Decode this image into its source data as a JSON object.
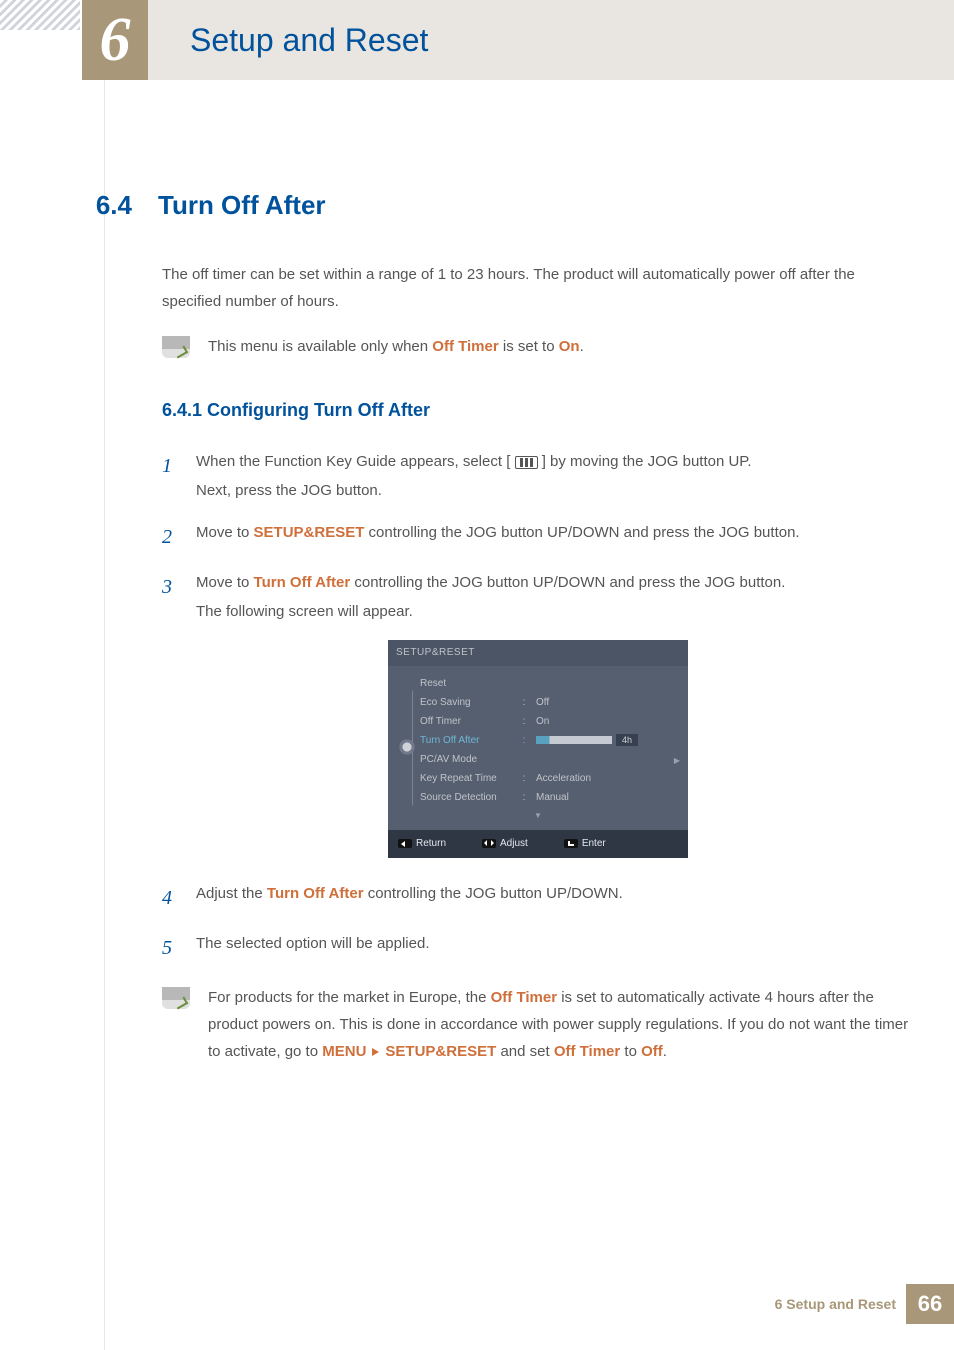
{
  "chapter": {
    "num": "6",
    "title": "Setup and Reset"
  },
  "section": {
    "num": "6.4",
    "title": "Turn Off After"
  },
  "intro": "The off timer can be set within a range of 1 to 23 hours. The product will automatically power off after the specified number of hours.",
  "note1": {
    "p1": "This menu is available only when ",
    "h1": "Off Timer",
    "p2": " is set to ",
    "h2": "On",
    "p3": "."
  },
  "subsection": "6.4.1   Configuring Turn Off After",
  "steps": {
    "s1a": "When the Function Key Guide appears, select ",
    "s1b": " by moving the JOG button UP.",
    "s1c": "Next, press the JOG button.",
    "s2a": "Move to ",
    "s2h": "SETUP&RESET",
    "s2b": " controlling the JOG button UP/DOWN and press the JOG button.",
    "s3a": "Move to ",
    "s3h": "Turn Off After",
    "s3b": " controlling the JOG button UP/DOWN and press the JOG button.",
    "s3c": "The following screen will appear.",
    "s4a": "Adjust the ",
    "s4h": "Turn Off After",
    "s4b": " controlling the JOG button UP/DOWN.",
    "s5": "The selected option will be applied."
  },
  "osd": {
    "header": "SETUP&RESET",
    "items": [
      {
        "label": "Reset",
        "value": ""
      },
      {
        "label": "Eco Saving",
        "value": "Off"
      },
      {
        "label": "Off Timer",
        "value": "On"
      },
      {
        "label": "Turn Off After",
        "value": "4h",
        "highlight": true,
        "bar": true
      },
      {
        "label": "PC/AV Mode",
        "value": "",
        "chev": true
      },
      {
        "label": "Key Repeat Time",
        "value": "Acceleration"
      },
      {
        "label": "Source Detection",
        "value": "Manual"
      }
    ],
    "footer": {
      "return": "Return",
      "adjust": "Adjust",
      "enter": "Enter"
    }
  },
  "note2": {
    "p1": "For products for the market in Europe, the ",
    "h1": "Off Timer",
    "p2": " is set to automatically activate 4 hours after the product powers on. This is done in accordance with power supply regulations. If you do not want the timer to activate, go to ",
    "h2": "MENU",
    "h3": "SETUP&RESET",
    "p3": " and set ",
    "h4": "Off Timer",
    "p4": " to ",
    "h5": "Off",
    "p5": "."
  },
  "footer": {
    "text": "6 Setup and Reset",
    "page": "66"
  }
}
